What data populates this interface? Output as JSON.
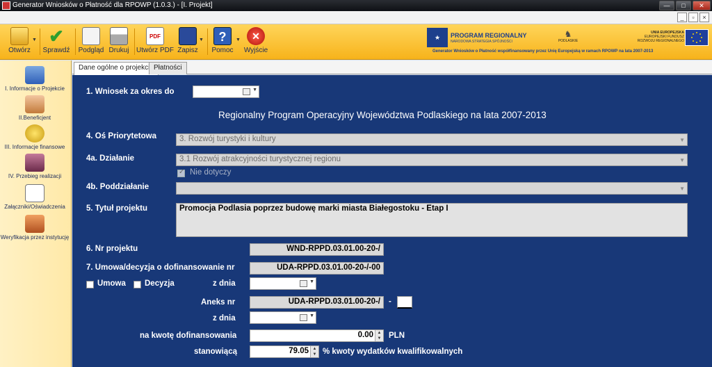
{
  "window": {
    "title": "Generator Wniosków o Płatność dla RPOWP (1.0.3.) - [I. Projekt]",
    "min": "—",
    "max": "□",
    "close": "✕"
  },
  "toolbar": {
    "otworz": "Otwórz",
    "sprawdz": "Sprawdź",
    "podglad": "Podgląd",
    "drukuj": "Drukuj",
    "utworz_pdf": "Utwórz PDF",
    "zapisz": "Zapisz",
    "pomoc": "Pomoc",
    "wyjscie": "Wyjście"
  },
  "banner": {
    "program": "PROGRAM REGIONALNY",
    "program_sub": "NARODOWA STRATEGIA SPÓJNOŚCI",
    "podlaskie": "PODLASKIE",
    "eu_title": "UNIA EUROPEJSKA",
    "eu_fund": "EUROPEJSKI FUNDUSZ",
    "eu_fund2": "ROZWOJU REGIONALNEGO",
    "caption": "Generator Wniosków o Płatność współfinansowany przez Unię Europejską w ramach RPOWP na lata 2007-2013"
  },
  "sidebar": {
    "items": [
      {
        "label": "I. Informacje o Projekcie"
      },
      {
        "label": "II.Beneficjent"
      },
      {
        "label": "III. Informacje finansowe"
      },
      {
        "label": "IV. Przebieg realizacji"
      },
      {
        "label": "Załączniki/Oświadczenia"
      },
      {
        "label": "Weryfikacja przez instytucję"
      }
    ]
  },
  "tabs": [
    {
      "label": "Dane ogólne o projekcie"
    },
    {
      "label": "Płatności"
    }
  ],
  "form": {
    "okres_label": "1. Wniosek za okres do",
    "heading": "Regionalny Program Operacyjny Województwa Podlaskiego na lata 2007-2013",
    "os_label": "4. Oś Priorytetowa",
    "os_value": "3. Rozwój turystyki i kultury",
    "dzialanie_label": "4a. Działanie",
    "dzialanie_value": "3.1 Rozwój atrakcyjności turystycznej regionu",
    "nie_dotyczy": "Nie dotyczy",
    "poddzialanie_label": "4b. Poddziałanie",
    "poddzialanie_value": "",
    "tytul_label": "5. Tytuł projektu",
    "tytul_value": "Promocja Podlasia poprzez budowę marki miasta Białegostoku - Etap I",
    "nr_label": "6. Nr projektu",
    "nr_value": "WND-RPPD.03.01.00-20-/",
    "umowa_label": "7. Umowa/decyzja o dofinansowanie nr",
    "umowa_value": "UDA-RPPD.03.01.00-20-/-00",
    "umowa_chk": "Umowa",
    "decyzja_chk": "Decyzja",
    "z_dnia": "z dnia",
    "aneks_label": "Aneks nr",
    "aneks_value": "UDA-RPPD.03.01.00-20-/",
    "aneks_dash": "-",
    "aneks_suffix": "",
    "z_dnia2": "z dnia",
    "kwota_label": "na kwotę dofinansowania",
    "kwota_value": "0.00",
    "kwota_unit": "PLN",
    "stanowiaca_label": "stanowiącą",
    "stanowiaca_value": "79.05",
    "stanowiaca_unit": "% kwoty wydatków kwalifikowalnych"
  }
}
